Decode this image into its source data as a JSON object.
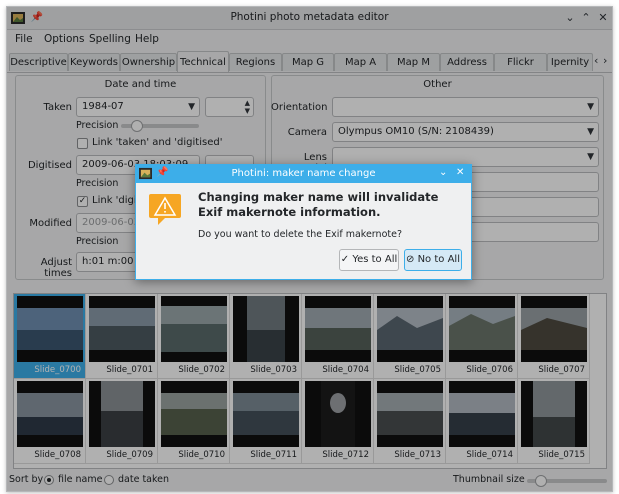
{
  "window": {
    "title": "Photini photo metadata editor",
    "controls": {
      "minimize": "⌄",
      "maximize": "⌃",
      "close": "✕"
    }
  },
  "menu": [
    "File",
    "Options",
    "Spelling",
    "Help"
  ],
  "tabs": [
    "Descriptive",
    "Keywords",
    "Ownership",
    "Technical",
    "Regions",
    "Map G",
    "Map A",
    "Map M",
    "Address",
    "Flickr",
    "Ipernity"
  ],
  "active_tab": "Technical",
  "date_time": {
    "title": "Date and time",
    "taken": {
      "label": "Taken",
      "value": "1984-07",
      "precision_label": "Precision"
    },
    "link_taken_digitised": "Link 'taken' and 'digitised'",
    "digitised": {
      "label": "Digitised",
      "value": "2009-06-03 18:03:09",
      "precision_label": "Precision"
    },
    "link_digitised_partial": "Link 'digitis",
    "modified": {
      "label": "Modified",
      "value": "2009-06-03 18:0",
      "precision_label": "Precision"
    },
    "adjust_times": {
      "label": "Adjust times",
      "value": "h:01 m:00 s:00"
    }
  },
  "other": {
    "title": "Other",
    "orientation": {
      "label": "Orientation",
      "value": ""
    },
    "camera": {
      "label": "Camera",
      "value": "Olympus OM10 (S/N: 2108439)"
    },
    "lens_model": {
      "label": "Lens model",
      "value": ""
    }
  },
  "thumbnails": [
    "Slide_0700",
    "Slide_0701",
    "Slide_0702",
    "Slide_0703",
    "Slide_0704",
    "Slide_0705",
    "Slide_0706",
    "Slide_0707",
    "Slide_0708",
    "Slide_0709",
    "Slide_0710",
    "Slide_0711",
    "Slide_0712",
    "Slide_0713",
    "Slide_0714",
    "Slide_0715"
  ],
  "selected_thumbnail": "Slide_0700",
  "status": {
    "sort_by": "Sort by",
    "file_name": "file name",
    "date_taken": "date taken",
    "thumbnail_size": "Thumbnail size"
  },
  "dialog": {
    "title": "Photini: maker name change",
    "heading": "Changing maker name will invalidate Exif makernote information.",
    "text": "Do you want to delete the Exif makernote?",
    "yes_label": "Yes to All",
    "no_label": "No to All"
  },
  "colors": {
    "accent": "#3daee9",
    "window_bg": "#eff0f1",
    "warning": "#f6a623"
  }
}
